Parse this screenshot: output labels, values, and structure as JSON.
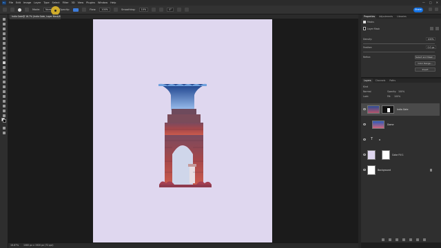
{
  "menubar": {
    "logo": "Ps",
    "items": [
      "File",
      "Edit",
      "Image",
      "Layer",
      "Type",
      "Select",
      "Filter",
      "3D",
      "View",
      "Plugins",
      "Window",
      "Help"
    ],
    "window_controls": [
      "—",
      "□",
      "✕"
    ]
  },
  "options": {
    "mode_label": "Mode:",
    "mode_value": "Normal",
    "opacity_label": "Opacity:",
    "opacity_value": "100%",
    "flow_label": "Flow:",
    "flow_value": "100%",
    "smoothing_label": "Smoothing:",
    "smoothing_value": "10%",
    "angle_value": "0°",
    "share_label": "Share"
  },
  "document": {
    "tab_title": "India Gate@ 16.7% (India Gate, Layer Mask/8) *"
  },
  "status": {
    "zoom": "16.67%",
    "doc_size": "1080 px x 1920 px (72 ppi)"
  },
  "properties": {
    "tabs": [
      "Properties",
      "Adjustments",
      "Libraries"
    ],
    "section_title": "Masks",
    "mask_type": "Layer Mask",
    "density_label": "Density:",
    "density_value": "100%",
    "feather_label": "Feather:",
    "feather_value": "0.0 px",
    "refine_label": "Refine:",
    "select_mask_button": "Select and Mask...",
    "color_range_button": "Color Range...",
    "invert_button": "Invert"
  },
  "layers": {
    "tabs": [
      "Layers",
      "Channels",
      "Paths"
    ],
    "kind_label": "Kind",
    "blend_mode": "Normal",
    "opacity_label": "Opacity:",
    "opacity_value": "100%",
    "lock_label": "Lock:",
    "fill_label": "Fill:",
    "fill_value": "100%",
    "rows": [
      {
        "name": "India Gate"
      },
      {
        "name": "Dome"
      },
      {
        "name": "T"
      },
      {
        "name": "Color Fill 1"
      },
      {
        "name": "Background"
      }
    ]
  },
  "colors": {
    "canvas": "#dfd7ef",
    "accent": "#1473e6"
  }
}
